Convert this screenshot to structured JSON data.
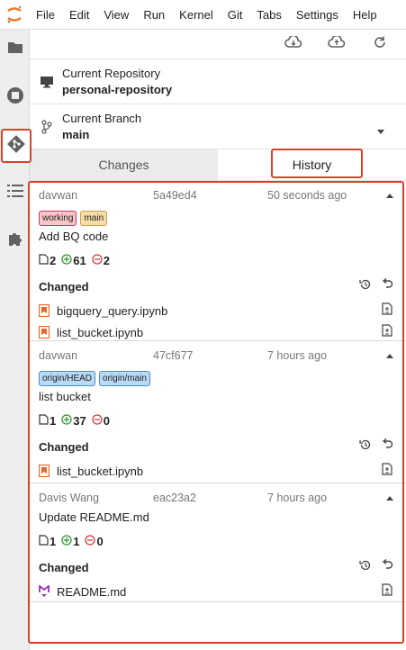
{
  "menu": [
    "File",
    "Edit",
    "View",
    "Run",
    "Kernel",
    "Git",
    "Tabs",
    "Settings",
    "Help"
  ],
  "repo": {
    "label": "Current Repository",
    "value": "personal-repository"
  },
  "branch": {
    "label": "Current Branch",
    "value": "main"
  },
  "tabs": {
    "changes": "Changes",
    "history": "History"
  },
  "changed_label": "Changed",
  "commits": [
    {
      "author": "davwan",
      "sha": "5a49ed4",
      "time": "50 seconds ago",
      "tags": [
        "working",
        "main"
      ],
      "summary": "Add BQ code",
      "files_changed": "2",
      "insertions": "61",
      "deletions": "2",
      "files": [
        {
          "name": "bigquery_query.ipynb",
          "icon": "notebook-icon"
        },
        {
          "name": "list_bucket.ipynb",
          "icon": "notebook-icon"
        }
      ]
    },
    {
      "author": "davwan",
      "sha": "47cf677",
      "time": "7 hours ago",
      "tags": [
        "origin/HEAD",
        "origin/main"
      ],
      "summary": "list bucket",
      "files_changed": "1",
      "insertions": "37",
      "deletions": "0",
      "files": [
        {
          "name": "list_bucket.ipynb",
          "icon": "notebook-icon"
        }
      ]
    },
    {
      "author": "Davis Wang",
      "sha": "eac23a2",
      "time": "7 hours ago",
      "tags": [],
      "summary": "Update README.md",
      "files_changed": "1",
      "insertions": "1",
      "deletions": "0",
      "files": [
        {
          "name": "README.md",
          "icon": "markdown-icon"
        }
      ]
    }
  ],
  "colors": {
    "accent": "#d9412b",
    "added": "#2e9b2e",
    "deleted": "#d23b3b",
    "notebook": "#e0662b",
    "markdown": "#9b2fb0"
  }
}
